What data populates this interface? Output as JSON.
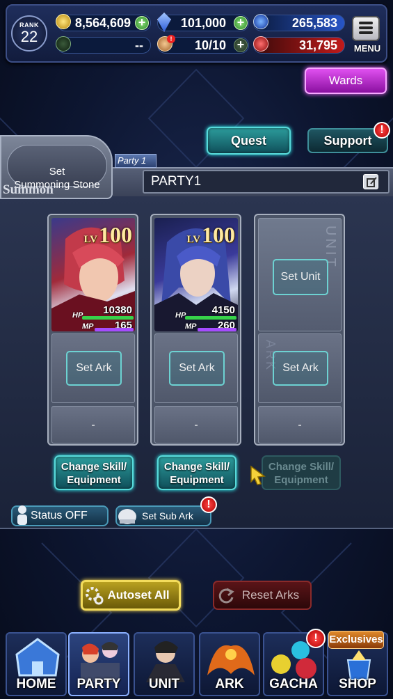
{
  "header": {
    "rank_label": "RANK",
    "rank_value": "22",
    "gold": "8,564,609",
    "crystals": "101,000",
    "blue_orbs": "265,583",
    "ap": "--",
    "stamina": "10/10",
    "red_orbs": "31,795",
    "menu_label": "MENU"
  },
  "buttons": {
    "wards": "Wards",
    "quest": "Quest",
    "support": "Support",
    "support_badge": "!",
    "set_summoning_stone": "Set\nSummoning Stone",
    "summon_label": "Summon",
    "party_tag": "Party 1",
    "party_name": "PARTY1",
    "status_off": "Status OFF",
    "set_sub_ark": "Set Sub Ark",
    "sub_ark_badge": "!",
    "autoset_all": "Autoset All",
    "reset_arks": "Reset Arks"
  },
  "units": [
    {
      "lv_label": "LV",
      "level": "100",
      "hp_label": "HP",
      "hp": "10380",
      "mp_label": "MP",
      "mp": "165",
      "ark_label": "Set Ark",
      "sub_slot": "-",
      "change_label": "Change Skill/\nEquipment"
    },
    {
      "lv_label": "LV",
      "level": "100",
      "hp_label": "HP",
      "hp": "4150",
      "mp_label": "MP",
      "mp": "260",
      "ark_label": "Set Ark",
      "sub_slot": "-",
      "change_label": "Change Skill/\nEquipment"
    },
    {
      "set_unit_label": "Set Unit",
      "ark_label": "Set Ark",
      "sub_slot": "-",
      "change_label": "Change Skill/\nEquipment",
      "watermark_unit": "UNIT",
      "watermark_ark": "ARK"
    }
  ],
  "nav": {
    "home": "HOME",
    "party": "PARTY",
    "unit": "UNIT",
    "ark": "ARK",
    "gacha": "GACHA",
    "gacha_badge": "!",
    "shop": "SHOP",
    "exclusives": "Exclusives"
  },
  "colors": {
    "accent_teal": "#58dada",
    "wards_purple": "#c020d8",
    "hp_green": "#37d24a",
    "mp_purple": "#a64cff"
  },
  "icons": [
    "gold-coin-icon",
    "blue-crystal-icon",
    "blue-orb-icon",
    "green-compass-icon",
    "stamina-icon",
    "red-orb-icon",
    "plus-icon",
    "menu-icon",
    "edit-icon",
    "person-icon",
    "helmet-icon",
    "gear-icon",
    "reset-icon",
    "cursor-icon"
  ]
}
